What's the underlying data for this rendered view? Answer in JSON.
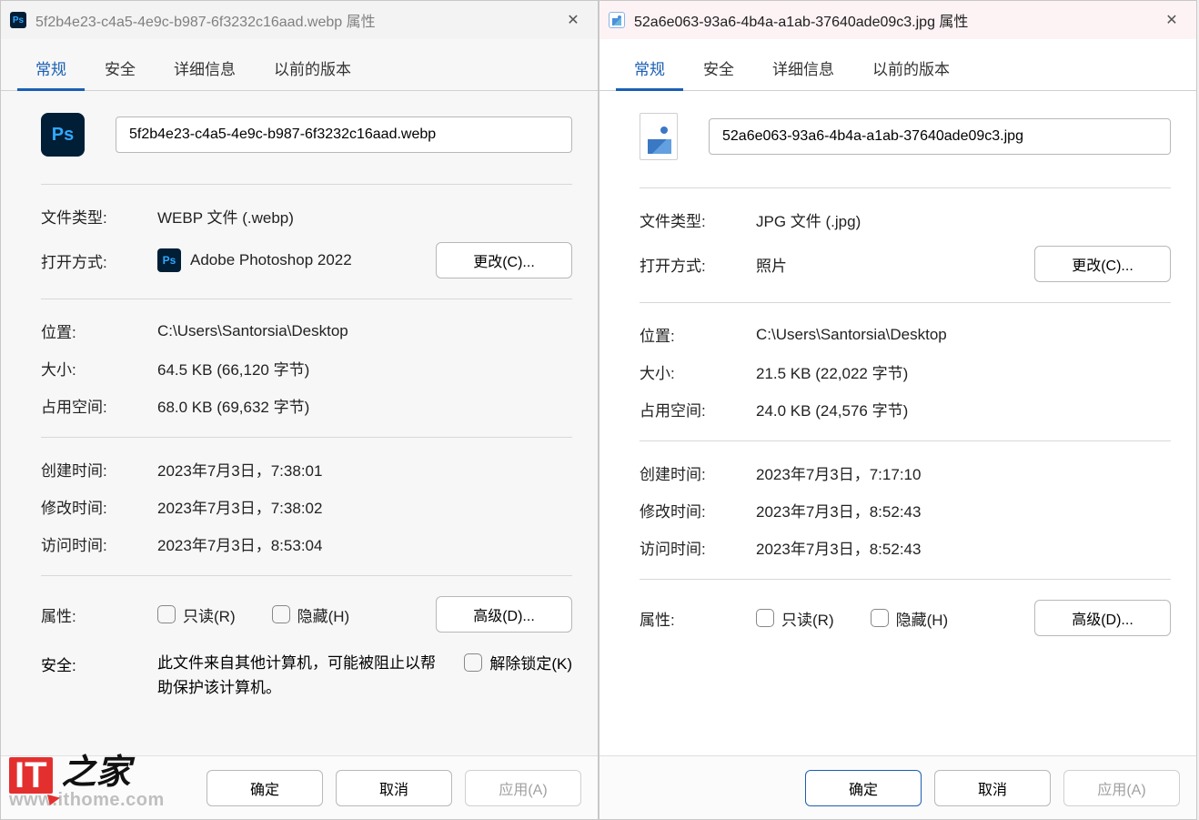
{
  "left": {
    "title": "5f2b4e23-c4a5-4e9c-b987-6f3232c16aad.webp 属性",
    "filename": "5f2b4e23-c4a5-4e9c-b987-6f3232c16aad.webp",
    "file_type_label": "文件类型:",
    "file_type_value": "WEBP 文件 (.webp)",
    "open_with_label": "打开方式:",
    "open_with_app": "Adobe Photoshop 2022",
    "change_btn": "更改(C)...",
    "location_label": "位置:",
    "location_value": "C:\\Users\\Santorsia\\Desktop",
    "size_label": "大小:",
    "size_value": "64.5 KB (66,120 字节)",
    "disk_label": "占用空间:",
    "disk_value": "68.0 KB (69,632 字节)",
    "created_label": "创建时间:",
    "created_value": "2023年7月3日，7:38:01",
    "modified_label": "修改时间:",
    "modified_value": "2023年7月3日，7:38:02",
    "accessed_label": "访问时间:",
    "accessed_value": "2023年7月3日，8:53:04",
    "attrs_label": "属性:",
    "readonly_label": "只读(R)",
    "hidden_label": "隐藏(H)",
    "advanced_btn": "高级(D)...",
    "security_label": "安全:",
    "security_text": "此文件来自其他计算机，可能被阻止以帮助保护该计算机。",
    "unblock_label": "解除锁定(K)"
  },
  "right": {
    "title": "52a6e063-93a6-4b4a-a1ab-37640ade09c3.jpg 属性",
    "filename": "52a6e063-93a6-4b4a-a1ab-37640ade09c3.jpg",
    "file_type_label": "文件类型:",
    "file_type_value": "JPG 文件 (.jpg)",
    "open_with_label": "打开方式:",
    "open_with_app": "照片",
    "change_btn": "更改(C)...",
    "location_label": "位置:",
    "location_value": "C:\\Users\\Santorsia\\Desktop",
    "size_label": "大小:",
    "size_value": "21.5 KB (22,022 字节)",
    "disk_label": "占用空间:",
    "disk_value": "24.0 KB (24,576 字节)",
    "created_label": "创建时间:",
    "created_value": "2023年7月3日，7:17:10",
    "modified_label": "修改时间:",
    "modified_value": "2023年7月3日，8:52:43",
    "accessed_label": "访问时间:",
    "accessed_value": "2023年7月3日，8:52:43",
    "attrs_label": "属性:",
    "readonly_label": "只读(R)",
    "hidden_label": "隐藏(H)",
    "advanced_btn": "高级(D)..."
  },
  "tabs": {
    "general": "常规",
    "security": "安全",
    "details": "详细信息",
    "versions": "以前的版本"
  },
  "footer": {
    "ok": "确定",
    "cancel": "取消",
    "apply": "应用(A)"
  },
  "watermark": {
    "logo": "IT",
    "zhijia": "之家",
    "url": "www.ithome.com"
  }
}
